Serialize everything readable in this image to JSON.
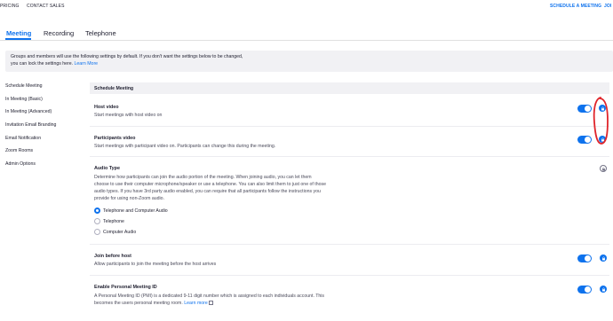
{
  "top_nav": {
    "pricing": "PRICING",
    "contact_sales": "CONTACT SALES",
    "schedule_meeting": "SCHEDULE A MEETING",
    "join": "JOI"
  },
  "tabs": [
    {
      "label": "Meeting",
      "active": true
    },
    {
      "label": "Recording",
      "active": false
    },
    {
      "label": "Telephone",
      "active": false
    }
  ],
  "notice": {
    "line1": "Groups and members will use the following settings by default. If you don't want the settings below to be changed,",
    "line2": "you can lock the settings here.",
    "link": "Learn More"
  },
  "sidebar": {
    "items": [
      {
        "label": "Schedule Meeting"
      },
      {
        "label": "In Meeting (Basic)"
      },
      {
        "label": "In Meeting (Advanced)"
      },
      {
        "label": "Invitation Email Branding"
      },
      {
        "label": "Email Notification"
      },
      {
        "label": "Zoom Rooms"
      },
      {
        "label": "Admin Options"
      }
    ]
  },
  "section": {
    "title": "Schedule Meeting"
  },
  "settings": {
    "host_video": {
      "title": "Host video",
      "desc": "Start meetings with host video on",
      "enabled": true,
      "locked": true
    },
    "participants_video": {
      "title": "Participants video",
      "desc": "Start meetings with participant video on. Participants can change this during the meeting.",
      "enabled": true,
      "locked": true
    },
    "audio_type": {
      "title": "Audio Type",
      "desc_lines": [
        "Determine how participants can join the audio portion of the meeting. When joining audio, you can let them",
        "choose to use their computer microphone/speaker or use a telephone. You can also limit them to just one of those",
        "audio types. If you have 3rd party audio enabled, you can require that all participants follow the instructions you",
        "provide for using non-Zoom audio."
      ],
      "locked": false,
      "options": [
        {
          "label": "Telephone and Computer Audio",
          "selected": true
        },
        {
          "label": "Telephone",
          "selected": false
        },
        {
          "label": "Computer Audio",
          "selected": false
        }
      ]
    },
    "join_before_host": {
      "title": "Join before host",
      "desc": "Allow participants to join the meeting before the host arrives",
      "enabled": true,
      "locked": true
    },
    "pmi": {
      "title": "Enable Personal Meeting ID",
      "desc_line1": "A Personal Meeting ID (PMI) is a dedicated 9-11 digit number which is assigned to each individuals account. This",
      "desc_line2": "becomes the users personal meeting room.",
      "link": "Learn more",
      "enabled": true,
      "locked": true
    }
  },
  "colors": {
    "accent": "#0E72ED",
    "annotation": "#E0252B"
  }
}
